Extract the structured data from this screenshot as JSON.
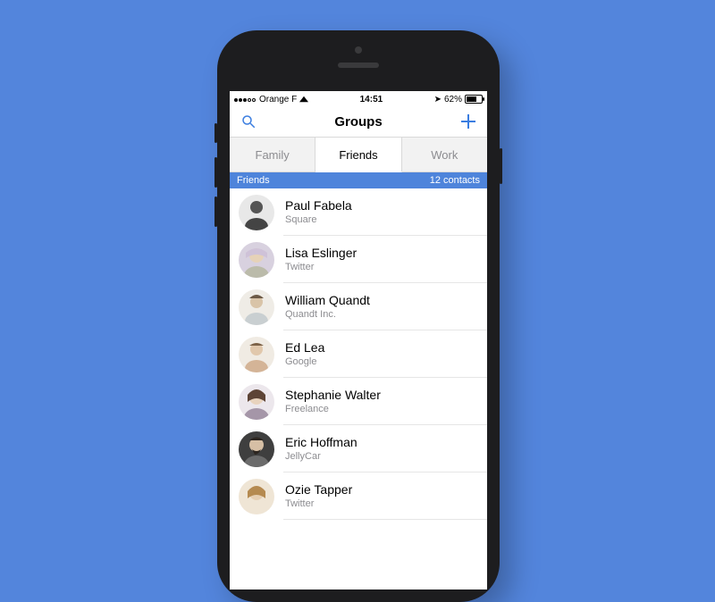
{
  "status": {
    "carrier": "Orange F",
    "time": "14:51",
    "battery_pct": "62%"
  },
  "nav": {
    "title": "Groups"
  },
  "tabs": [
    {
      "label": "Family",
      "active": false
    },
    {
      "label": "Friends",
      "active": true
    },
    {
      "label": "Work",
      "active": false
    }
  ],
  "section": {
    "title": "Friends",
    "count": "12 contacts"
  },
  "contacts": [
    {
      "name": "Paul Fabela",
      "sub": "Square"
    },
    {
      "name": "Lisa Eslinger",
      "sub": "Twitter"
    },
    {
      "name": "William Quandt",
      "sub": "Quandt Inc."
    },
    {
      "name": "Ed Lea",
      "sub": "Google"
    },
    {
      "name": "Stephanie Walter",
      "sub": "Freelance"
    },
    {
      "name": "Eric Hoffman",
      "sub": "JellyCar"
    },
    {
      "name": "Ozie Tapper",
      "sub": "Twitter"
    }
  ]
}
